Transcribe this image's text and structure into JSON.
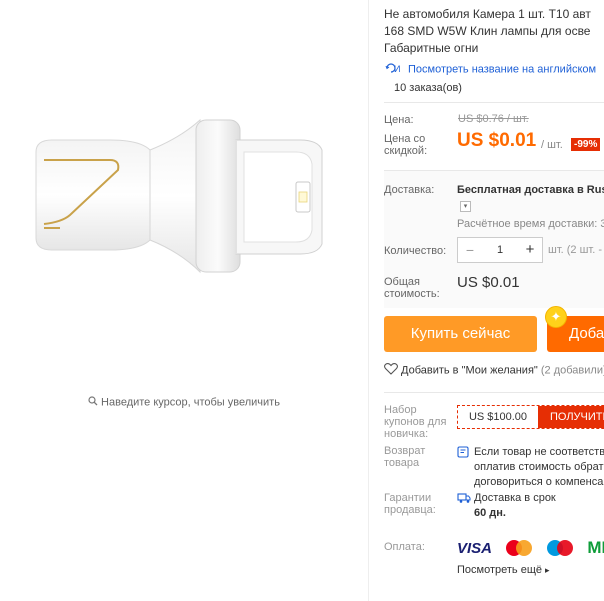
{
  "zoom_hint": "Наведите курсор, чтобы увеличить",
  "title_lines": [
    "Не автомобиля Камера 1 шт. T10 авт",
    "168 SMD W5W Клин лампы для осве",
    "Габаритные огни"
  ],
  "translate_link": "Посмотреть название на английском",
  "orders": "10 заказа(ов)",
  "price": {
    "label": "Цена:",
    "old": "US $0.76 / шт.",
    "discount_label_1": "Цена со",
    "discount_label_2": "скидкой:",
    "current": "US $0.01",
    "per_unit": "/ шт.",
    "discount_badge": "-99%"
  },
  "shipping": {
    "label": "Доставка:",
    "value": "Бесплатная доставка в Russ",
    "time": "Расчётное время доставки: 3("
  },
  "quantity": {
    "label": "Количество:",
    "value": "1",
    "available": "шт. (2 шт. -"
  },
  "total": {
    "label_1": "Общая",
    "label_2": "стоимость:",
    "value": "US $0.01"
  },
  "buttons": {
    "buy_now": "Купить сейчас",
    "add_to_cart": "Доба"
  },
  "wishlist": {
    "text": "Добавить в \"Мои желания\"",
    "count": "(2 добавили)"
  },
  "coupon": {
    "label_1": "Набор",
    "label_2": "купонов для",
    "label_3": "новичка:",
    "amount": "US $100.00",
    "get": "ПОЛУЧИТЬ"
  },
  "returns": {
    "label_1": "Возврат",
    "label_2": "товара",
    "lines": [
      "Если товар не соответству",
      "оплатив стоимость обратн",
      "договориться о компенсац"
    ]
  },
  "guarantee": {
    "label_1": "Гарантии",
    "label_2": "продавца:",
    "line1": "Доставка в срок",
    "line2": "60 дн."
  },
  "payment": {
    "label": "Оплата:",
    "visa": "VISA",
    "mir": "МИ",
    "more": "Посмотреть ещё"
  },
  "colors": {
    "accent": "#ff6a00",
    "buy_button": "#ff9a26",
    "discount": "#e62e04",
    "link": "#1d5fd6"
  }
}
